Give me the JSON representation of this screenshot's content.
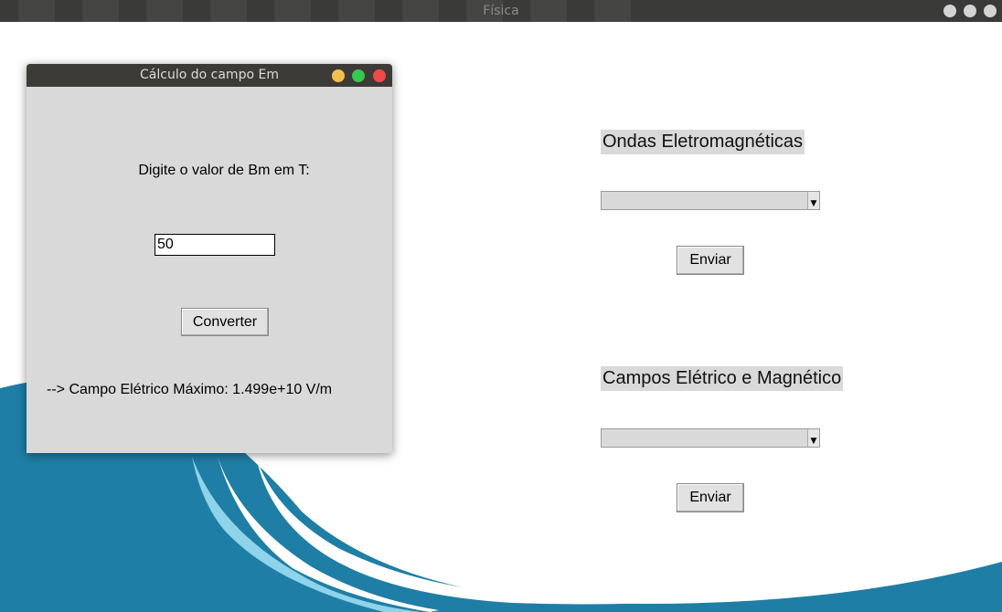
{
  "main_window": {
    "title": "Física"
  },
  "dialog": {
    "title": "Cálculo do campo Em",
    "prompt": "Digite o valor de Bm em T:",
    "input_value": "50",
    "convert_button": "Converter",
    "result": "--> Campo Elétrico Máximo: 1.499e+10 V/m"
  },
  "right_panel": {
    "section1": {
      "label": "Ondas Eletromagnéticas",
      "select_value": "",
      "button": "Enviar"
    },
    "section2": {
      "label": "Campos Elétrico e Magnético",
      "select_value": "",
      "button": "Enviar"
    }
  },
  "colors": {
    "titlebar": "#3c3b37",
    "dialog_bg": "#d9d9d9",
    "minimize": "#f4bf4f",
    "maximize": "#37c84f",
    "close": "#f2484c",
    "wave_dark": "#1f7ea6",
    "wave_light": "#8fd3ea"
  }
}
